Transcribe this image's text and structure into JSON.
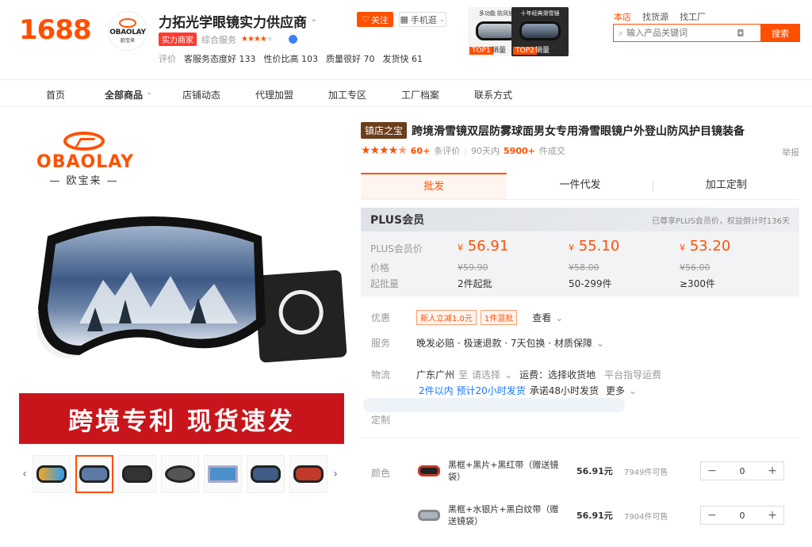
{
  "header": {
    "logo": "1688",
    "shop_logo_brand": "OBAOLAY",
    "shop_logo_cn": "欧宝来",
    "shop_name": "力拓光学眼镜实力供应商",
    "follow_label": "关注",
    "mobile_label": "手机逛",
    "power_badge": "实力商家",
    "service_label": "综合服务",
    "eval_label": "评价",
    "eval_items": [
      "客服务态度好 133",
      "性价比高 103",
      "质量很好 70",
      "发货快 61"
    ],
    "promos": [
      {
        "title": "多功能 防风镜",
        "tag": "TOP1",
        "tag_text": "销量"
      },
      {
        "title": "十年经典滑雪镜",
        "tag": "TOP2",
        "tag_text": "销量"
      }
    ],
    "top_links": [
      "本店",
      "找货源",
      "找工厂"
    ],
    "search_placeholder": "输入产品关键词",
    "search_btn": "搜索"
  },
  "nav": {
    "items": [
      "首页",
      "全部商品",
      "店铺动态",
      "代理加盟",
      "加工专区",
      "工厂档案",
      "联系方式"
    ]
  },
  "gallery": {
    "brand_name": "OBAOLAY",
    "brand_cn": "— 欧宝来 —",
    "banner_text": "跨境专利 现货速发"
  },
  "product": {
    "treasure_badge": "镇店之宝",
    "title": "跨境滑雪镜双层防雾球面男女专用滑雪眼镜户外登山防风护目镜装备",
    "rating_count": "60+",
    "rating_count_label": "条评价",
    "sold_period": "90天内",
    "sold_count": "5900+",
    "sold_label": "件成交",
    "report": "举报",
    "tabs": [
      "批发",
      "一件代发",
      "加工定制"
    ],
    "plus": {
      "title": "PLUS会员",
      "note": "已尊享PLUS会员价，权益倒计时136天",
      "member_price_label": "PLUS会员价",
      "price_label": "价格",
      "moq_label": "起批量",
      "tiers": [
        {
          "member_price": "56.91",
          "price": "¥59.90",
          "qty": "2件起批"
        },
        {
          "member_price": "55.10",
          "price": "¥58.00",
          "qty": "50-299件"
        },
        {
          "member_price": "53.20",
          "price": "¥56.00",
          "qty": "≥300件"
        }
      ],
      "yen": "¥"
    },
    "discount": {
      "label": "优惠",
      "coupons": [
        "新人立减1.0元",
        "1件混批"
      ],
      "view": "查看"
    },
    "service": {
      "label": "服务",
      "text": "晚发必赔 · 极速退款 · 7天包换 · 材质保障"
    },
    "logistics": {
      "label": "物流",
      "from": "广东广州",
      "to_word": "至",
      "select": "请选择",
      "freight": "运费：选择收货地",
      "guide": "平台指导运费",
      "ship_blue": "2件以内 预计20小时发货",
      "promise": "承诺48小时发货",
      "more": "更多"
    },
    "custom_label": "定制",
    "color_label": "颜色",
    "skus": [
      {
        "name": "黑框+黑片+黑红带（赠送镜袋）",
        "price": "56.91元",
        "stock": "7949件可售",
        "qty": "0"
      },
      {
        "name": "黑框+水银片+黑白纹带（赠送镜袋）",
        "price": "56.91元",
        "stock": "7904件可售",
        "qty": "0"
      }
    ]
  },
  "colors": {
    "accent": "#ff5000",
    "banner": "#c8151b",
    "treasure": "#6b3e1d"
  }
}
